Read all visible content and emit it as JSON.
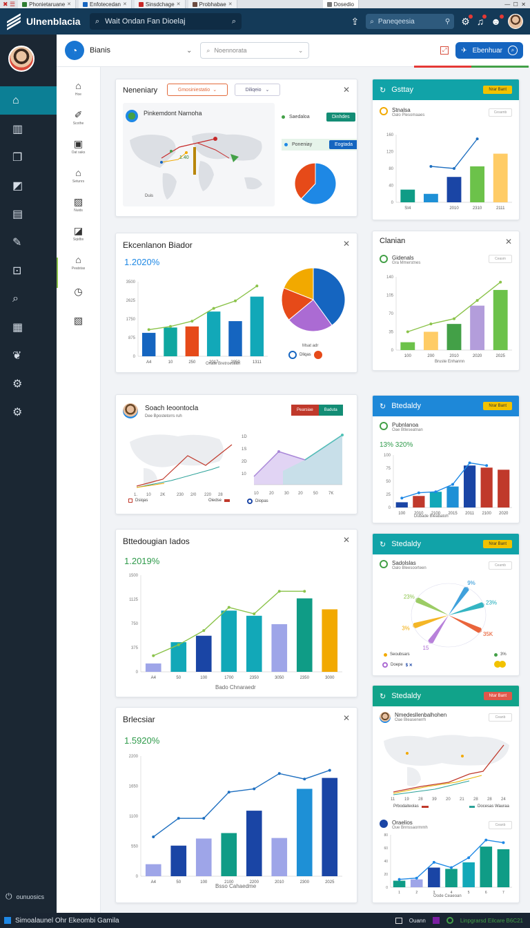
{
  "browser": {
    "tabs": [
      {
        "label": "Phonietaruane",
        "color": "#2e7d32"
      },
      {
        "label": "Enfotecedan",
        "color": "#1565c0"
      },
      {
        "label": "Sinsdchage",
        "color": "#c62828"
      },
      {
        "label": "Probhabae",
        "color": "#6d4c41"
      },
      {
        "label": "Dosedio",
        "color": "#777777"
      }
    ]
  },
  "header": {
    "app_title": "Ulnenblacia",
    "search_text": "Wait Ondan Fan Dioelaj",
    "filter_text": "Paneqeesia"
  },
  "toolbar": {
    "title": "Bianis",
    "select_placeholder": "Noennorata",
    "button_label": "Ebenhuar"
  },
  "sidebar": {
    "footer_label": "ounuosics"
  },
  "subnav": {
    "items": [
      "Hoe",
      "Scothe",
      "Oat saks",
      "Setunrs",
      "Nuids",
      "Sqidbs",
      "Peatstas",
      "",
      ""
    ]
  },
  "cards": {
    "summary": {
      "title": "Neneniary",
      "dropdown1": "Gmosiniestatio",
      "dropdown2": "Diliqeio",
      "profile_name": "Pinkemdont Narnoha",
      "side_label": "Saedaloa",
      "pill_green": "Dinhdes",
      "side_label2": "Poneniay",
      "pill_blue": "Eogtada",
      "map_labels": [
        "1.40",
        "Duis"
      ]
    },
    "expansion": {
      "title": "Ekcenlanon Biador",
      "metric": "1.2020%",
      "x_label": "Onate Bretroesiiah",
      "legend": [
        "Msat adr",
        "Dliqas"
      ]
    },
    "search": {
      "title": "Soach Ieoontocla",
      "subtitle": "Dee Bpostetorrs ruh",
      "pill_red": "Pearsiae",
      "pill_green": "Baduta",
      "legend": [
        "Dsiqas",
        "Oiedse",
        "Diopas"
      ]
    },
    "breakdown": {
      "title": "Bttedougian Iados",
      "metric": "1.2019%",
      "x_label": "Bado Chnaraedr"
    },
    "brics": {
      "title": "Brlecsiar",
      "metric": "1.5920%",
      "x_label": "Bsso Cahaedme"
    },
    "right1": {
      "head": "Gsttay",
      "pill": "Nrar Bant",
      "sub1": "Stnalsa",
      "sub2": "Oalo Plesomaaes",
      "mini": "Cesamb"
    },
    "right2": {
      "head": "Clanian",
      "sub1": "Gidenals",
      "sub2": "Gra Mmerstnes",
      "mini": "Ceasm",
      "x_label": "Bruste Enhannn"
    },
    "right3": {
      "head": "Btedaldy",
      "pill": "Nrar Bant",
      "sub1": "Pubnlanoa",
      "sub2": "Oae Btleseatnan",
      "metric": "13% 320%",
      "x_label": "Dubade Bleabatoh"
    },
    "right4": {
      "head": "Stedaldy",
      "pill": "Nrar Bant",
      "sub1": "Sadolslas",
      "sub2": "Oalo Bleesoorteen",
      "mini": "Ceamb",
      "legend": [
        "Seoubsars",
        "Doepe",
        "3%"
      ]
    },
    "right5": {
      "head": "Stedaldy",
      "pill": "Ntar Bant",
      "sub1": "Nmedesllenbalhohen",
      "sub2": "Oae Bleasenerrh",
      "mini": "Ceanb",
      "map_legend": [
        "Prbodaiteolas",
        "Docesas Wauraa"
      ],
      "sub3": "Oraelios",
      "sub4": "Oue Bnnssaormmh",
      "x_label": "Oode Ceaeoan"
    }
  },
  "statusbar": {
    "left": "Simoalaunel Ohr Ekeombi Gamila",
    "right1": "Ouann",
    "right2": "Linpgrarsd Eilcare B6C21"
  },
  "chart_data": [
    {
      "type": "bar",
      "title": "Ekcenlanon Biador",
      "categories": [
        "A4",
        "10",
        "250",
        "2017",
        "2050",
        "1311"
      ],
      "series": [
        {
          "values": [
            1100,
            1350,
            1400,
            2100,
            1650,
            2800
          ]
        }
      ],
      "overlay_line": [
        1250,
        1400,
        1650,
        2250,
        2600,
        3300
      ],
      "ylim": [
        0,
        3500
      ],
      "colors": [
        "#1565c0",
        "#0fa7a0",
        "#e64a19",
        "#12a8b8",
        "#1565c0",
        "#12a8b8"
      ]
    },
    {
      "type": "pie",
      "title": "Ekcenlanon Biador",
      "values": [
        40,
        24,
        17,
        19
      ],
      "colors": [
        "#1565c0",
        "#ab6bd3",
        "#e64a19",
        "#f2a900"
      ]
    },
    {
      "type": "bar",
      "title": "Bttedougian Iados",
      "categories": [
        "A4",
        "50",
        "100",
        "1700",
        "2350",
        "3050",
        "2350",
        "3000"
      ],
      "series": [
        {
          "values": [
            130,
            460,
            560,
            950,
            870,
            740,
            1140,
            970
          ]
        }
      ],
      "overlay_line": [
        250,
        420,
        640,
        1000,
        900,
        1250,
        1250,
        null
      ],
      "ylim": [
        0,
        1500
      ],
      "colors": [
        "#9ea5e8",
        "#12a8b8",
        "#1a45a5",
        "#12a8b8",
        "#12a8b8",
        "#9ea5e8",
        "#0f9c86",
        "#f2a900"
      ]
    },
    {
      "type": "bar",
      "title": "Brlecsiar",
      "categories": [
        "A4",
        "50",
        "100",
        "2100",
        "2200",
        "2010",
        "2300",
        "2025"
      ],
      "series": [
        {
          "values": [
            220,
            560,
            690,
            790,
            1200,
            700,
            1600,
            1800
          ]
        }
      ],
      "overlay_line": [
        720,
        1060,
        1060,
        1540,
        1600,
        1880,
        1780,
        1940
      ],
      "ylim": [
        0,
        2200
      ],
      "colors": [
        "#9ea5e8",
        "#1a45a5",
        "#9ea5e8",
        "#0f9c86",
        "#1a45a5",
        "#9ea5e8",
        "#1e90d6",
        "#1a45a5"
      ]
    },
    {
      "type": "bar",
      "title": "Gsttay",
      "categories": [
        "SI4",
        "",
        "2010",
        "2310",
        "2111"
      ],
      "series": [
        {
          "values": [
            30,
            20,
            60,
            85,
            115
          ]
        }
      ],
      "overlay_line": [
        null,
        85,
        80,
        150,
        null
      ],
      "ylim": [
        0,
        160
      ],
      "colors": [
        "#0f9c86",
        "#1e90d6",
        "#1a45a5",
        "#6cc24a",
        "#ffcc66"
      ]
    },
    {
      "type": "bar",
      "title": "Clanian",
      "categories": [
        "100",
        "200",
        "2010",
        "2020",
        "2025"
      ],
      "series": [
        {
          "values": [
            15,
            35,
            50,
            85,
            115
          ]
        }
      ],
      "overlay_line": [
        35,
        50,
        60,
        95,
        130
      ],
      "ylim": [
        0,
        140
      ],
      "colors": [
        "#6cc24a",
        "#ffcc66",
        "#43a047",
        "#b39ddb",
        "#6cc24a"
      ]
    },
    {
      "type": "bar",
      "title": "Btedaldy",
      "categories": [
        "100",
        "2010",
        "2100",
        "2015",
        "2011",
        "2100",
        "2020"
      ],
      "series": [
        {
          "values": [
            10,
            22,
            30,
            40,
            80,
            76,
            72
          ]
        }
      ],
      "overlay_line": [
        18,
        28,
        30,
        44,
        85,
        80,
        null
      ],
      "ylim": [
        0,
        100
      ],
      "colors": [
        "#1a45a5",
        "#c0392b",
        "#12a8b8",
        "#1e90d6",
        "#1a45a5",
        "#c0392b",
        "#c0392b"
      ]
    },
    {
      "type": "pie",
      "title": "Stedaldy",
      "values": [
        20,
        20,
        15,
        15,
        15,
        15
      ],
      "labels": [
        "23%",
        "9%",
        "23%",
        "35K",
        "15",
        "3%"
      ],
      "colors": [
        "#8bc34a",
        "#1e90d6",
        "#12a8b8",
        "#e64a19",
        "#ab6bd3",
        "#f2a900"
      ]
    },
    {
      "type": "bar",
      "title": "Stedaldy",
      "categories": [
        "1",
        "2",
        "3",
        "4",
        "5",
        "6",
        "7"
      ],
      "series": [
        {
          "values": [
            10,
            12,
            30,
            28,
            38,
            62,
            58
          ]
        }
      ],
      "overlay_line": [
        12,
        14,
        38,
        30,
        45,
        72,
        68
      ],
      "ylim": [
        0,
        80
      ],
      "colors": [
        "#0f9c86",
        "#9ea5e8",
        "#1a45a5",
        "#0f9c86",
        "#12a8b8",
        "#0f9c86",
        "#0f9c86"
      ]
    }
  ]
}
